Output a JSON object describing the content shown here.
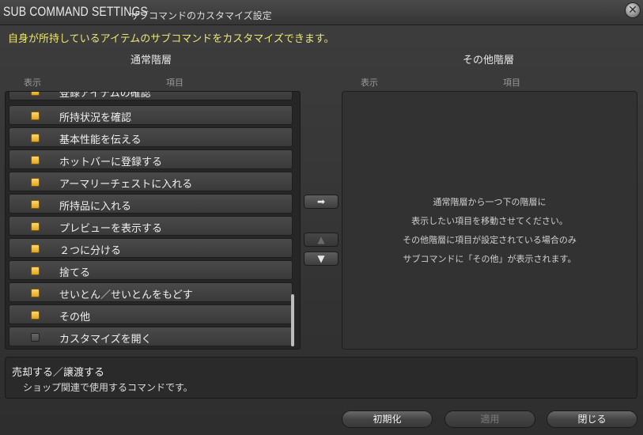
{
  "window": {
    "title": "SUB COMMAND SETTINGS",
    "subtitle": "サブコマンドのカスタマイズ設定",
    "close_icon": "close-icon"
  },
  "description": "自身が所持しているアイテムのサブコマンドをカスタマイズできます。",
  "left": {
    "title": "通常階層",
    "col_display": "表示",
    "col_item": "項目",
    "items": [
      {
        "label": "登録アイテムの確認",
        "checked": true
      },
      {
        "label": "所持状況を確認",
        "checked": true
      },
      {
        "label": "基本性能を伝える",
        "checked": true
      },
      {
        "label": "ホットバーに登録する",
        "checked": true
      },
      {
        "label": "アーマリーチェストに入れる",
        "checked": true
      },
      {
        "label": "所持品に入れる",
        "checked": true
      },
      {
        "label": "プレビューを表示する",
        "checked": true
      },
      {
        "label": "２つに分ける",
        "checked": true
      },
      {
        "label": "捨てる",
        "checked": true
      },
      {
        "label": "せいとん／せいとんをもどす",
        "checked": true
      },
      {
        "label": "その他",
        "checked": true
      },
      {
        "label": "カスタマイズを開く",
        "checked": false
      }
    ]
  },
  "right": {
    "title": "その他階層",
    "col_display": "表示",
    "col_item": "項目",
    "message": [
      "通常階層から一つ下の階層に",
      "表示したい項目を移動させてください。",
      "その他階層に項目が設定されている場合のみ",
      "サブコマンドに「その他」が表示されます。"
    ]
  },
  "mid_buttons": {
    "move_right": "➡",
    "move_up": "▲",
    "move_down": "▼"
  },
  "info": {
    "title": "売却する／譲渡する",
    "text": "ショップ関連で使用するコマンドです。"
  },
  "footer": {
    "reset": "初期化",
    "apply": "適用",
    "close": "閉じる"
  }
}
